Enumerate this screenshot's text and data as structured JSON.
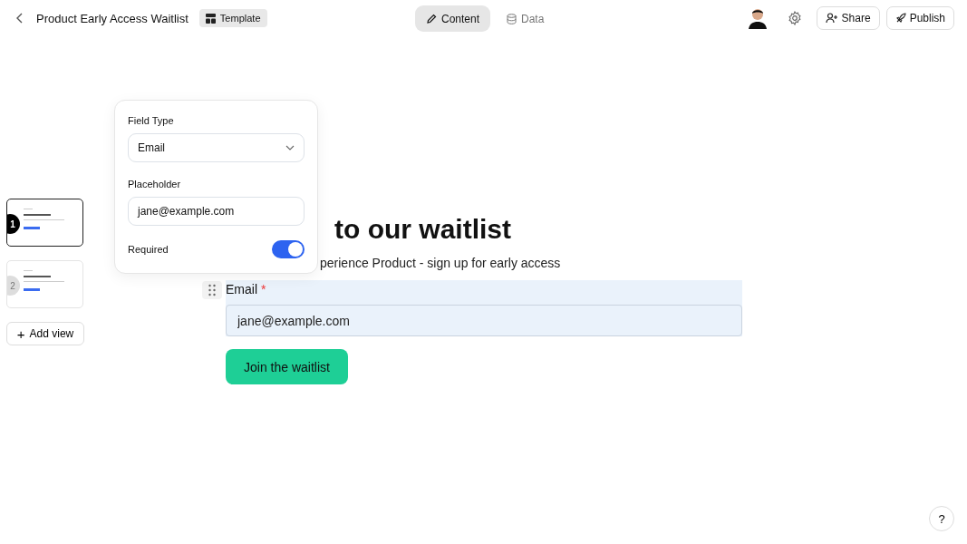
{
  "topbar": {
    "title": "Product Early Access Waitlist",
    "badge": "Template",
    "tabs": [
      {
        "label": "Content",
        "kind": "pencil",
        "selected": true
      },
      {
        "label": "Data",
        "kind": "database",
        "selected": false
      }
    ],
    "share": "Share",
    "publish": "Publish"
  },
  "views": [
    {
      "number": "1",
      "selected": true
    },
    {
      "number": "2",
      "selected": false
    }
  ],
  "add_view": "Add view",
  "add_view_plus": "+",
  "field_settings": {
    "type_label": "Field Type",
    "type_value": "Email",
    "placeholder_label": "Placeholder",
    "placeholder_value": "jane@example.com",
    "required_label": "Required",
    "required_on": true
  },
  "form": {
    "heading": "to our waitlist",
    "subtitle": "perience Product - sign up for early access",
    "field_label": "Email",
    "required": true,
    "required_mark": "*",
    "placeholder": "jane@example.com",
    "submit": "Join the waitlist"
  },
  "help": "?"
}
